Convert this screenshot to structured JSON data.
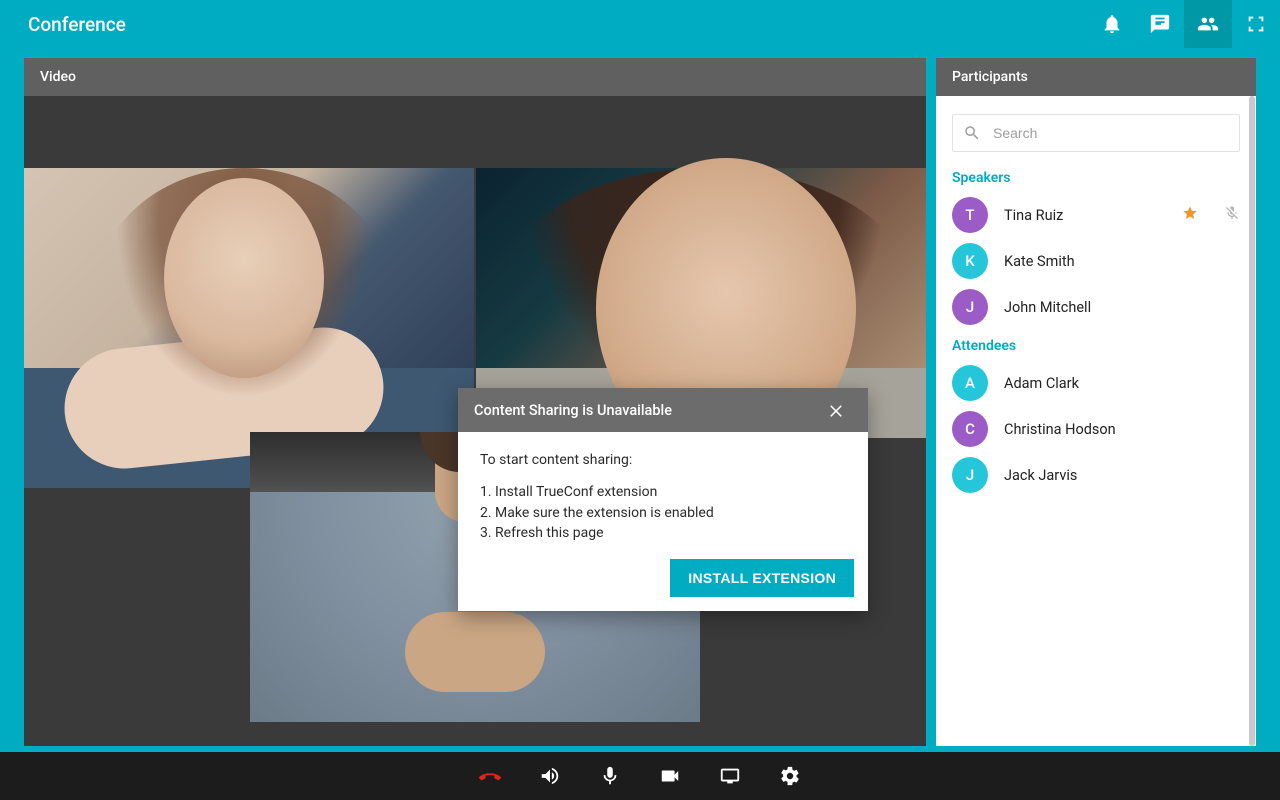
{
  "header": {
    "title": "Conference"
  },
  "videoPanel": {
    "title": "Video"
  },
  "participantsPanel": {
    "title": "Participants",
    "search": {
      "placeholder": "Search"
    },
    "sections": {
      "speakers": {
        "label": "Speakers",
        "items": [
          {
            "initial": "T",
            "name": "Tina Ruiz",
            "color": "#9c5cc7",
            "starred": true,
            "muted": true
          },
          {
            "initial": "K",
            "name": "Kate Smith",
            "color": "#26c6da"
          },
          {
            "initial": "J",
            "name": "John Mitchell",
            "color": "#9c5cc7"
          }
        ]
      },
      "attendees": {
        "label": "Attendees",
        "items": [
          {
            "initial": "A",
            "name": "Adam Clark",
            "color": "#26c6da"
          },
          {
            "initial": "C",
            "name": "Christina Hodson",
            "color": "#9c5cc7"
          },
          {
            "initial": "J",
            "name": "Jack Jarvis",
            "color": "#26c6da"
          }
        ]
      }
    }
  },
  "dialog": {
    "title": "Content Sharing is Unavailable",
    "intro": "To start content sharing:",
    "steps": [
      "1. Install TrueConf extension",
      "2. Make sure the extension is enabled",
      "3. Refresh this page"
    ],
    "action": "INSTALL EXTENSION"
  },
  "topbarIcons": {
    "notifications": "bell-icon",
    "chat": "chat-icon",
    "participants": "people-icon",
    "fullscreen": "fullscreen-icon"
  },
  "bottomControls": {
    "hangup": "hangup-icon",
    "speaker": "speaker-icon",
    "mic": "mic-icon",
    "camera": "camera-icon",
    "share": "screen-share-icon",
    "settings": "gear-icon"
  }
}
